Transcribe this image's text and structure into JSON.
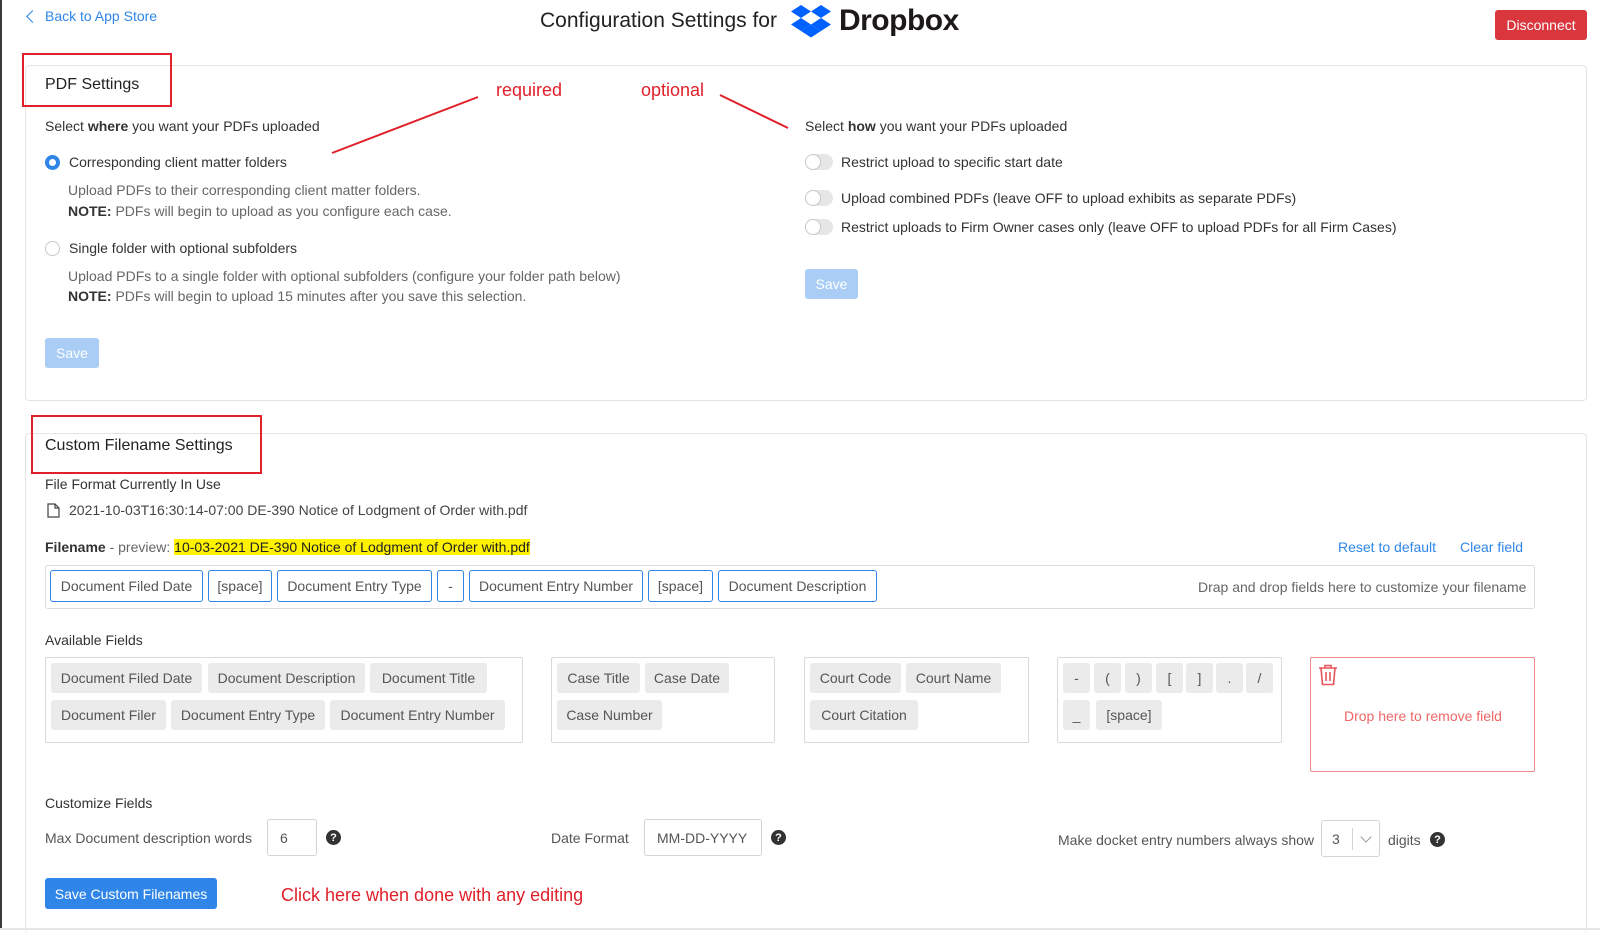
{
  "header": {
    "back_label": "Back to App Store",
    "title": "Configuration Settings for",
    "brand_name": "Dropbox",
    "disconnect_label": "Disconnect"
  },
  "annotations": {
    "required": "required",
    "optional": "optional",
    "save_hint": "Click here when done with any editing"
  },
  "pdf_settings": {
    "title": "PDF Settings",
    "where_prefix": "Select ",
    "where_bold": "where",
    "where_suffix": " you want your PDFs uploaded",
    "option1_label": "Corresponding client matter folders",
    "option1_desc": "Upload PDFs to their corresponding client matter folders.",
    "option1_note_label": "NOTE:",
    "option1_note": " PDFs will begin to upload as you configure each case.",
    "option2_label": "Single folder with optional subfolders",
    "option2_desc": "Upload PDFs to a single folder with optional subfolders (configure your folder path below)",
    "option2_note_label": "NOTE:",
    "option2_note": " PDFs will begin to upload 15 minutes after you save this selection.",
    "save_label": "Save",
    "how_prefix": "Select ",
    "how_bold": "how",
    "how_suffix": " you want your PDFs uploaded",
    "toggle1": "Restrict upload to specific start date",
    "toggle2": "Upload combined PDFs (leave OFF to upload exhibits as separate PDFs)",
    "toggle3": "Restrict uploads to Firm Owner cases only (leave OFF to upload PDFs for all Firm Cases)",
    "save2_label": "Save"
  },
  "custom": {
    "title": "Custom Filename Settings",
    "format_heading": "File Format Currently In Use",
    "current_file": "2021-10-03T16:30:14-07:00 DE-390 Notice of Lodgment of Order with.pdf",
    "filename_label": "Filename",
    "preview_label": " - preview: ",
    "preview_value": "10-03-2021 DE-390 Notice of Lodgment of Order with.pdf",
    "reset_label": "Reset to default",
    "clear_label": "Clear field",
    "drop_hint": "Drap and drop fields here to customize your filename",
    "selected_fields": [
      "Document Filed Date",
      "[space]",
      "Document Entry Type",
      "-",
      "Document Entry Number",
      "[space]",
      "Document Description"
    ],
    "available_heading": "Available Fields",
    "doc_fields": [
      "Document Filed Date",
      "Document Description",
      "Document Title",
      "Document Filer",
      "Document Entry Type",
      "Document Entry Number"
    ],
    "case_fields": [
      "Case Title",
      "Case Date",
      "Case Number"
    ],
    "court_fields": [
      "Court Code",
      "Court Name",
      "Court Citation"
    ],
    "symbol_fields": [
      "-",
      "(",
      ")",
      "[",
      "]",
      ".",
      "/",
      "_",
      "[space]"
    ],
    "remove_label": "Drop here to remove field",
    "customize_heading": "Customize Fields",
    "max_words_label": "Max Document description words",
    "max_words_value": "6",
    "date_format_label": "Date Format",
    "date_format_value": "MM-DD-YYYY",
    "docket_label": "Make docket entry numbers always show",
    "docket_value": "3",
    "digits_label": "digits",
    "help_glyph": "?",
    "save_label": "Save Custom Filenames"
  }
}
